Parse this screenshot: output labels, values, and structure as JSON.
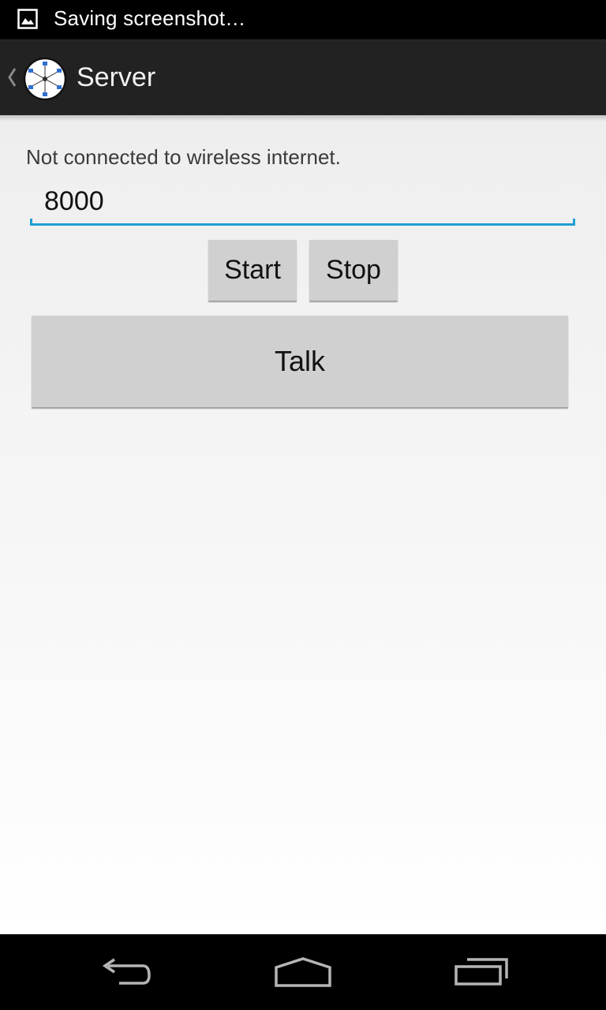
{
  "status_bar": {
    "notification_icon": "image-icon",
    "text": "Saving screenshot…"
  },
  "action_bar": {
    "up_icon": "chevron-left-icon",
    "app_icon": "network-hub-icon",
    "title": "Server"
  },
  "main": {
    "status_message": "Not connected to wireless internet.",
    "port_input": {
      "value": "8000",
      "placeholder": ""
    },
    "buttons": {
      "start_label": "Start",
      "stop_label": "Stop",
      "talk_label": "Talk"
    }
  },
  "nav_bar": {
    "back_icon": "back-icon",
    "home_icon": "home-icon",
    "recents_icon": "recents-icon"
  },
  "colors": {
    "accent": "#1e9fd0",
    "action_bar": "#222222",
    "button": "#d0d0d0"
  }
}
